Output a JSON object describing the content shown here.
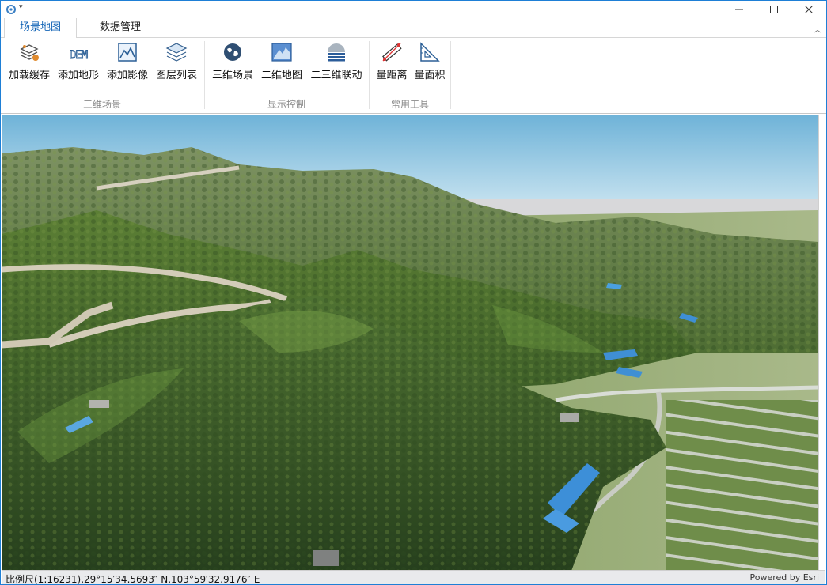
{
  "titlebar": {
    "app_icon": "gear-refresh-icon",
    "quick_access": "▾"
  },
  "tabs": [
    {
      "label": "场景地图",
      "active": true
    },
    {
      "label": "数据管理",
      "active": false
    }
  ],
  "ribbon": {
    "groups": [
      {
        "title": "三维场景",
        "buttons": [
          {
            "label": "加载缓存",
            "icon": "load-cache-icon"
          },
          {
            "label": "添加地形",
            "icon": "dem-icon"
          },
          {
            "label": "添加影像",
            "icon": "image-icon"
          },
          {
            "label": "图层列表",
            "icon": "layers-icon"
          }
        ]
      },
      {
        "title": "显示控制",
        "buttons": [
          {
            "label": "三维场景",
            "icon": "globe-icon"
          },
          {
            "label": "二维地图",
            "icon": "map-icon"
          },
          {
            "label": "二三维联动",
            "icon": "sync-view-icon"
          }
        ]
      },
      {
        "title": "常用工具",
        "buttons": [
          {
            "label": "量距离",
            "icon": "ruler-icon"
          },
          {
            "label": "量面积",
            "icon": "triangle-ruler-icon"
          }
        ]
      }
    ]
  },
  "status": {
    "coordinates": "比例尺(1:16231),29°15′34.5693″ N,103°59′32.9176″ E",
    "attribution": "Powered by Esri"
  },
  "colors": {
    "accent": "#1566b7",
    "sky_top": "#78b9dc",
    "sky_horizon": "#d6ecf5",
    "terrain_dark": "#2f4d26",
    "terrain_mid": "#56792f",
    "terrain_light": "#8fa86a",
    "roof_blue": "#3d8fd8"
  }
}
